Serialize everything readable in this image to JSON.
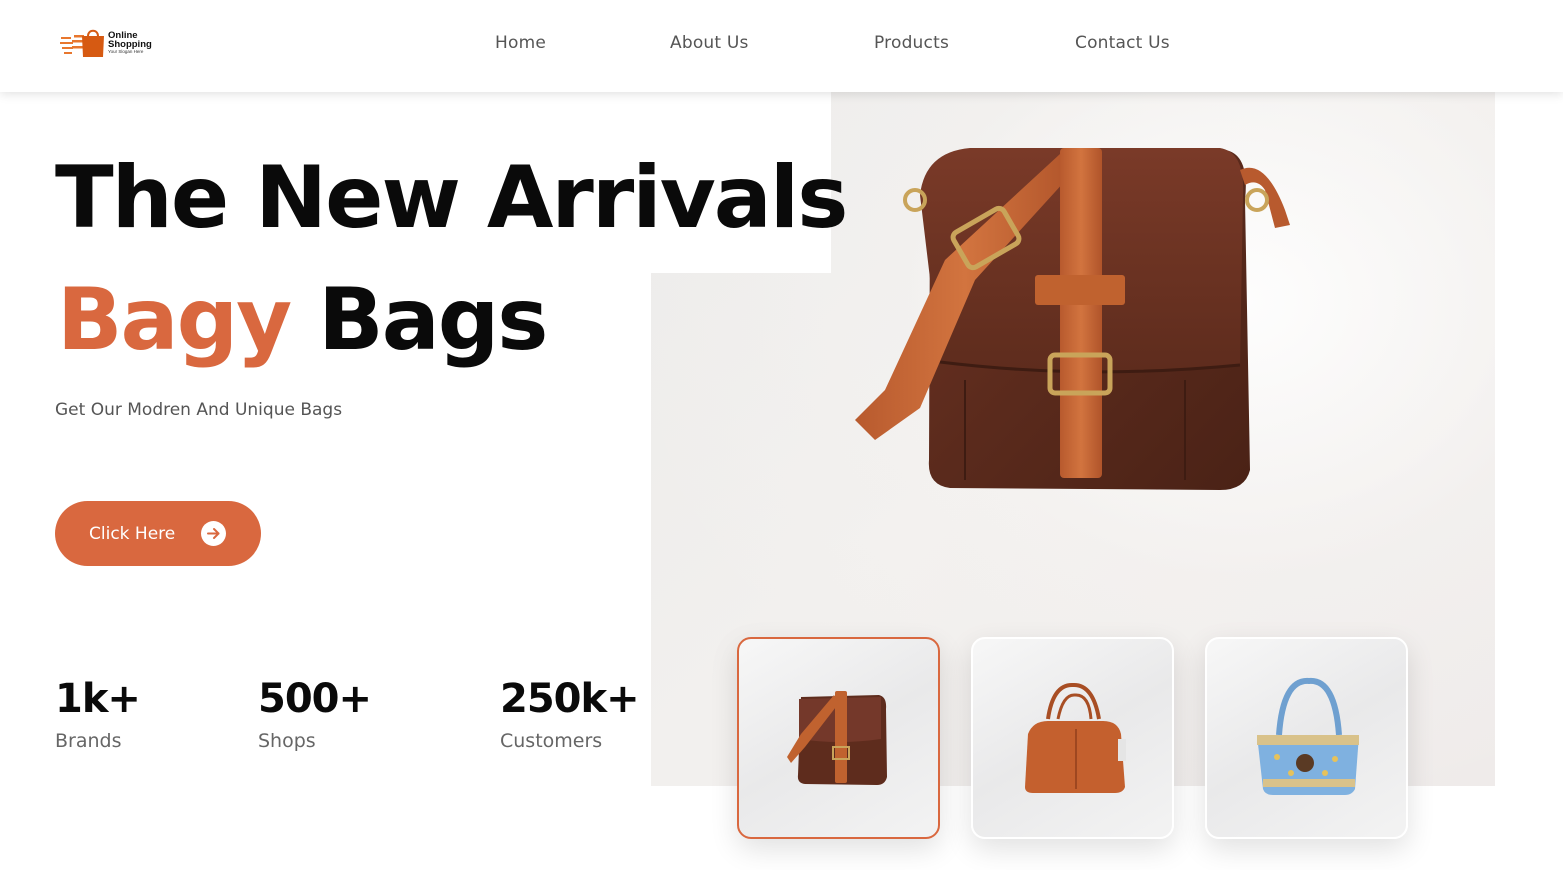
{
  "brand": {
    "name_line1": "Online",
    "name_line2": "Shopping",
    "slogan": "Your Slogan Here",
    "logo_icon": "shopping-bag-icon",
    "accent_color": "#d9683f"
  },
  "nav": {
    "items": [
      {
        "label": "Home"
      },
      {
        "label": "About Us"
      },
      {
        "label": "Products"
      },
      {
        "label": "Contact Us"
      }
    ]
  },
  "hero": {
    "headline_line1": "The New Arrivals",
    "headline_accent": "Bagy",
    "headline_rest": "Bags",
    "subtitle": "Get Our Modren And Unique Bags",
    "cta_label": "Click Here",
    "cta_icon": "arrow-right-circle-icon"
  },
  "stats": [
    {
      "value": "1k+",
      "label": "Brands"
    },
    {
      "value": "500+",
      "label": "Shops"
    },
    {
      "value": "250k+",
      "label": "Customers"
    }
  ],
  "gallery": {
    "main_image": "brown-leather-messenger-bag",
    "thumbnails": [
      {
        "image": "brown-leather-messenger-bag",
        "selected": true
      },
      {
        "image": "tan-leather-handbag",
        "selected": false
      },
      {
        "image": "blue-patterned-tote-bag",
        "selected": false
      }
    ]
  }
}
